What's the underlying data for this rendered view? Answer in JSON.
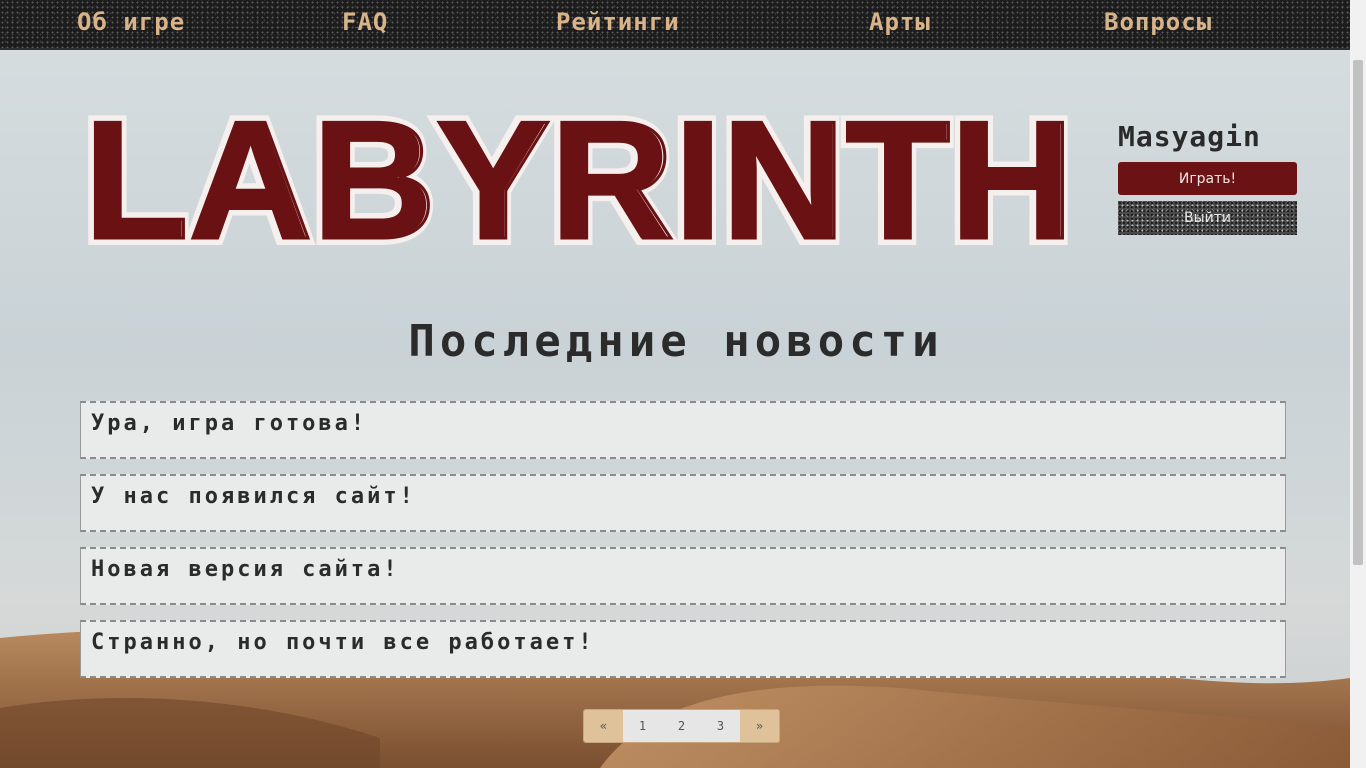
{
  "nav": {
    "items": [
      {
        "label": "Об игре"
      },
      {
        "label": "FAQ"
      },
      {
        "label": "Рейтинги"
      },
      {
        "label": "Арты"
      },
      {
        "label": "Вопросы"
      }
    ]
  },
  "logo": {
    "text": "LABYRINTH"
  },
  "user": {
    "name": "Masyagin",
    "play_label": "Играть!",
    "exit_label": "Выйти"
  },
  "news": {
    "title": "Последние новости",
    "items": [
      {
        "text": "Ура, игра готова!"
      },
      {
        "text": "У нас появился сайт!"
      },
      {
        "text": "Новая версия сайта!"
      },
      {
        "text": "Странно, но почти все работает!"
      }
    ]
  },
  "pagination": {
    "prev": "«",
    "pages": [
      "1",
      "2",
      "3"
    ],
    "next": "»"
  },
  "colors": {
    "accent": "#6b1314",
    "nav_text": "#d9b489",
    "nav_bg": "#1c1c1c"
  }
}
